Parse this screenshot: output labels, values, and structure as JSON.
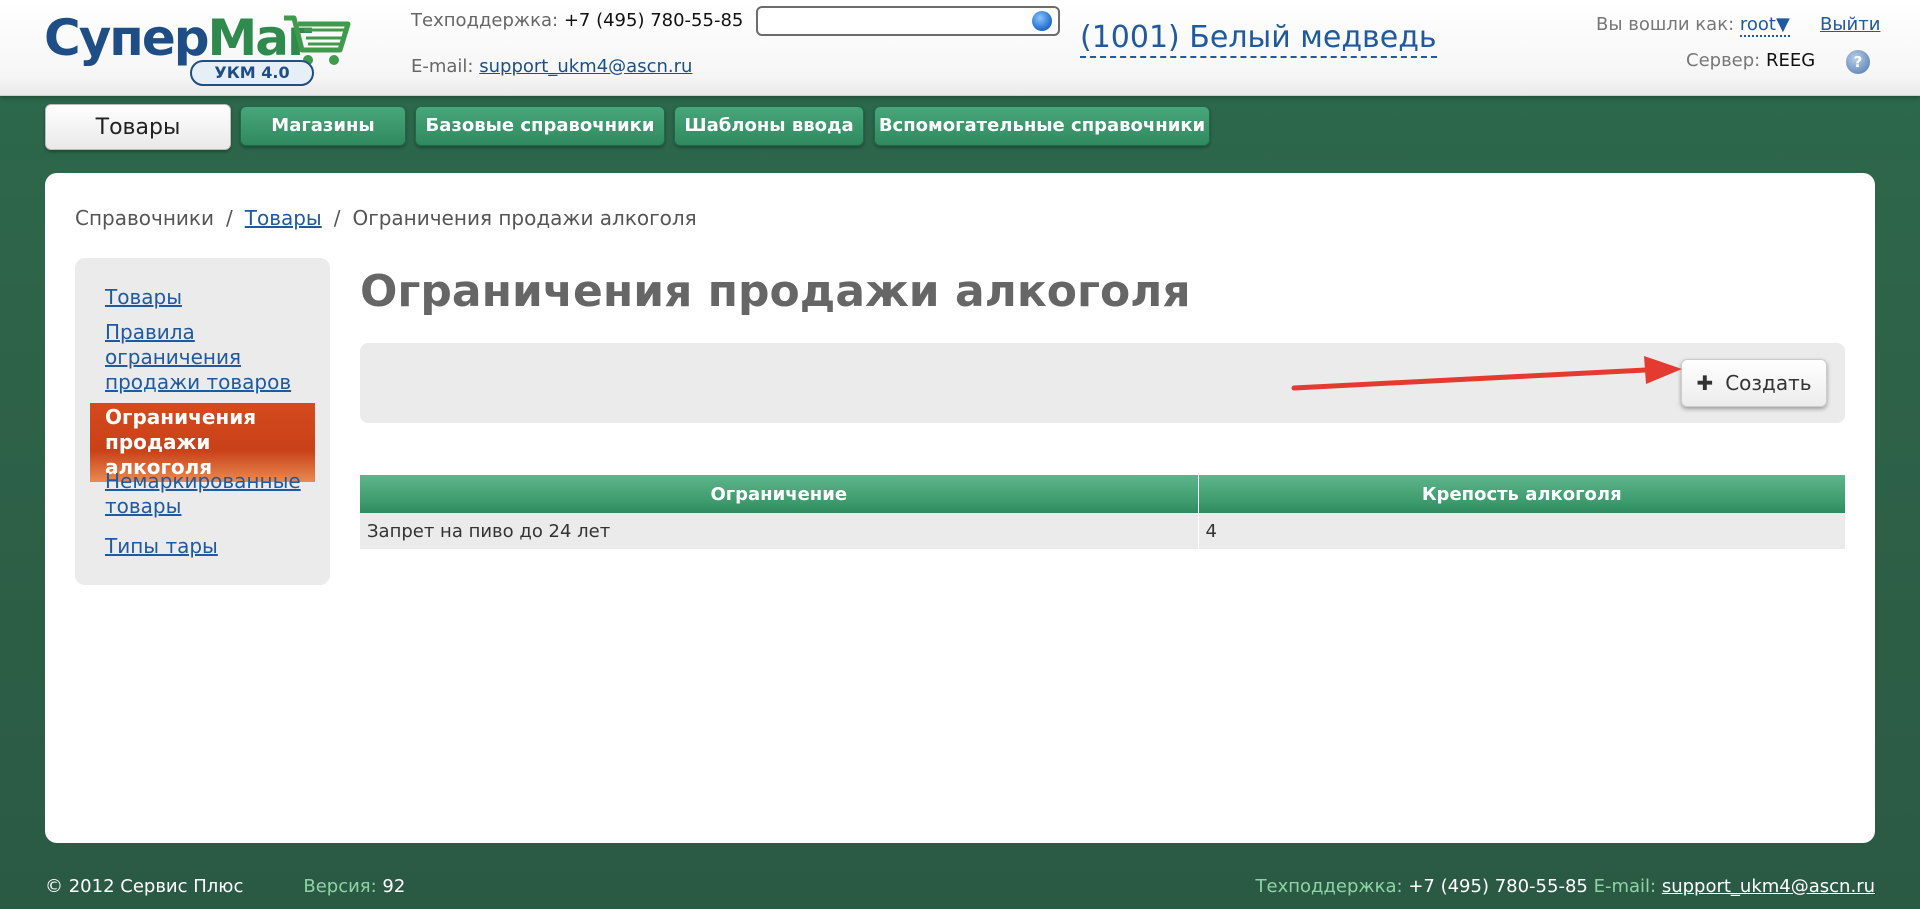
{
  "header": {
    "logo_main": "Супер",
    "logo_accent": "Маг",
    "logo_badge": "УКМ 4.0",
    "support_label": "Техподдержка:",
    "support_phone": "+7 (495) 780-55-85",
    "email_label": "E-mail:",
    "email": "support_ukm4@ascn.ru",
    "search_value": "",
    "store": "(1001) Белый медведь",
    "logged_label": "Вы вошли как:",
    "user": "root▼",
    "logout": "Выйти",
    "server_label": "Сервер:",
    "server": "REEG",
    "help": "?"
  },
  "tabs": [
    {
      "label": "Товары"
    },
    {
      "label": "Магазины"
    },
    {
      "label": "Базовые справочники"
    },
    {
      "label": "Шаблоны ввода"
    },
    {
      "label": "Вспомогательные справочники"
    }
  ],
  "breadcrumb": {
    "root": "Справочники",
    "sep": "/",
    "link": "Товары",
    "current": "Ограничения продажи алкоголя"
  },
  "sidebar": {
    "items": [
      {
        "label": "Товары"
      },
      {
        "label": "Правила ограничения продажи товаров"
      },
      {
        "label": "Ограничения продажи алкоголя"
      },
      {
        "label": "Немаркированные товары"
      },
      {
        "label": "Типы тары"
      }
    ]
  },
  "main": {
    "title": "Ограничения продажи алкоголя",
    "create_plus": "✚",
    "create_label": "Создать"
  },
  "table": {
    "columns": [
      "Ограничение",
      "Крепость алкоголя"
    ],
    "rows": [
      [
        "Запрет на пиво до 24 лет",
        "4"
      ]
    ]
  },
  "footer": {
    "copyright": "© 2012 Сервис Плюс",
    "version_label": "Версия:",
    "version": "92",
    "support_label": "Техподдержка:",
    "support_phone": "+7 (495) 780-55-85",
    "email_label": "E-mail:",
    "email": "support_ukm4@ascn.ru"
  },
  "colors": {
    "background_green": "#2e6349",
    "tab_green": "#3d9b6d",
    "active_orange": "#d54a1e",
    "link_blue": "#1f5aa0",
    "arrow_red": "#e53a2f"
  }
}
